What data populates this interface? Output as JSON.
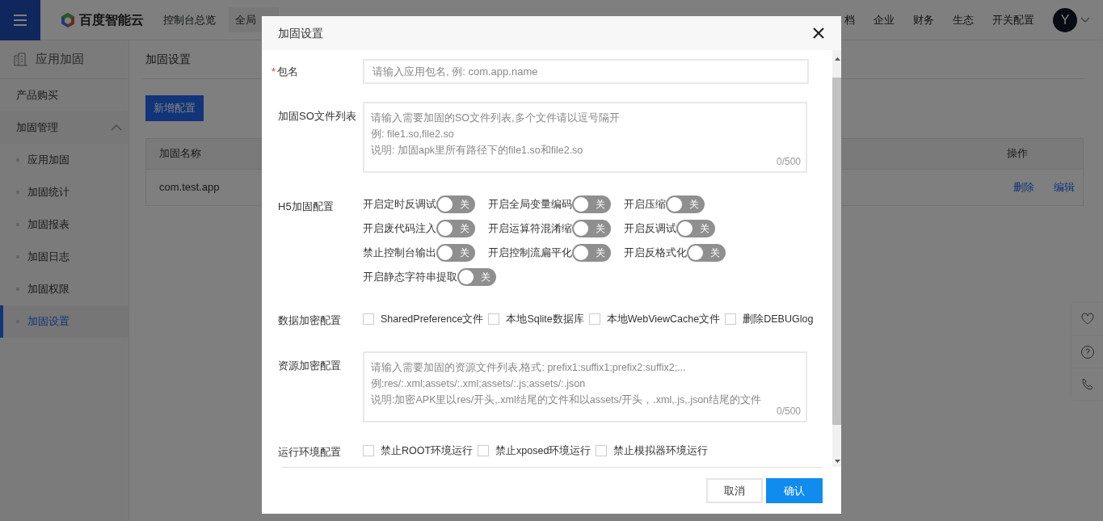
{
  "topbar": {
    "logo_text": "百度智能云",
    "overview": "控制台总览",
    "region": "全局",
    "nav": [
      "档",
      "企业",
      "财务",
      "生态",
      "开关配置"
    ],
    "avatar": "Y"
  },
  "sidebar": {
    "title": "应用加固",
    "items": [
      {
        "kind": "link",
        "label": "产品购买",
        "selected": false
      },
      {
        "kind": "group",
        "label": "加固管理",
        "expanded": true,
        "children": [
          {
            "label": "应用加固",
            "selected": false
          },
          {
            "label": "加固统计",
            "selected": false
          },
          {
            "label": "加固报表",
            "selected": false
          },
          {
            "label": "加固日志",
            "selected": false
          },
          {
            "label": "加固权限",
            "selected": false
          },
          {
            "label": "加固设置",
            "selected": true
          }
        ]
      }
    ]
  },
  "main": {
    "title": "加固设置",
    "add_button": "新增配置",
    "table": {
      "columns": [
        "加固名称",
        "操作"
      ],
      "rows": [
        {
          "name": "com.test.app",
          "actions": [
            "删除",
            "编辑"
          ]
        }
      ]
    }
  },
  "modal": {
    "title": "加固设置",
    "fields": [
      {
        "kind": "input",
        "label": "包名",
        "marker": "*",
        "placeholder": "请输入应用包名, 例: com.app.name"
      },
      {
        "kind": "textarea",
        "label": "加固SO文件列表",
        "placeholder_lines": [
          "请输入需要加固的SO文件列表,多个文件请以逗号隔开",
          "例: file1.so,file2.so",
          "说明: 加固apk里所有路径下的file1.so和file2.so"
        ],
        "counter": "0/500"
      },
      {
        "kind": "switches",
        "label": "H5加固配置",
        "rows": [
          [
            {
              "label": "开启定时反调试",
              "on": false,
              "text": "关"
            },
            {
              "label": "开启全局变量编码",
              "on": false,
              "text": "关"
            },
            {
              "label": "开启压缩",
              "on": false,
              "text": "关"
            }
          ],
          [
            {
              "label": "开启废代码注入",
              "on": false,
              "text": "关"
            },
            {
              "label": "开启运算符混淆缩",
              "on": false,
              "text": "关"
            },
            {
              "label": "开启反调试",
              "on": false,
              "text": "关"
            }
          ],
          [
            {
              "label": "禁止控制台输出",
              "on": false,
              "text": "关"
            },
            {
              "label": "开启控制流扁平化",
              "on": false,
              "text": "关"
            },
            {
              "label": "开启反格式化",
              "on": false,
              "text": "关"
            }
          ],
          [
            {
              "label": "开启静态字符串提取",
              "on": false,
              "text": "关"
            }
          ]
        ]
      },
      {
        "kind": "checkboxes",
        "label": "数据加密配置",
        "options": [
          {
            "label": "SharedPreference文件",
            "checked": false
          },
          {
            "label": "本地Sqlite数据库",
            "checked": false
          },
          {
            "label": "本地WebViewCache文件",
            "checked": false
          },
          {
            "label": "删除DEBUGlog",
            "checked": false
          }
        ]
      },
      {
        "kind": "textarea",
        "label": "资源加密配置",
        "placeholder_lines": [
          "请输入需要加固的资源文件列表,格式: prefix1:suffix1;prefix2:suffix2;...",
          "例:res/:.xml;assets/:.xml;assets/:.js;assets/:.json",
          "说明:加密APK里以res/开头,.xml结尾的文件和以assets/开头，.xml,.js,.json结尾的文件"
        ],
        "counter": "0/500"
      },
      {
        "kind": "checkboxes",
        "label": "运行环境配置",
        "options": [
          {
            "label": "禁止ROOT环境运行",
            "checked": false
          },
          {
            "label": "禁止xposed环境运行",
            "checked": false
          },
          {
            "label": "禁止模拟器环境运行",
            "checked": false
          }
        ]
      }
    ],
    "buttons": [
      {
        "kind": "default",
        "label": "取消"
      },
      {
        "kind": "primary",
        "label": "确认"
      }
    ]
  }
}
